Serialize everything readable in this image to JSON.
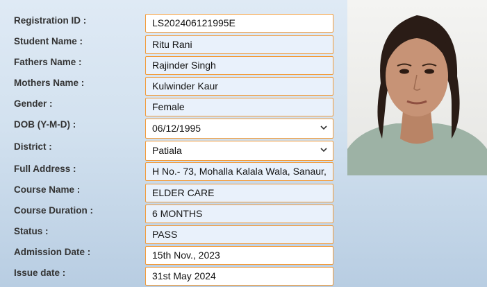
{
  "fields": [
    {
      "label": "Registration ID :",
      "value": "LS202406121995E",
      "style": "white"
    },
    {
      "label": "Student Name :",
      "value": "Ritu Rani",
      "style": "blue"
    },
    {
      "label": "Fathers Name :",
      "value": "Rajinder Singh",
      "style": "blue"
    },
    {
      "label": "Mothers Name :",
      "value": "Kulwinder Kaur",
      "style": "blue"
    },
    {
      "label": "Gender :",
      "value": "Female",
      "style": "blue"
    },
    {
      "label": "DOB (Y-M-D) :",
      "value": "06/12/1995",
      "style": "select"
    },
    {
      "label": "District :",
      "value": "Patiala",
      "style": "select"
    },
    {
      "label": "Full Address :",
      "value": "H No.- 73, Mohalla Kalala Wala, Sanaur,",
      "style": "blue"
    },
    {
      "label": "Course Name :",
      "value": "ELDER CARE",
      "style": "blue"
    },
    {
      "label": "Course Duration :",
      "value": "6 MONTHS",
      "style": "blue"
    },
    {
      "label": "Status :",
      "value": "PASS",
      "style": "blue"
    },
    {
      "label": "Admission Date :",
      "value": "15th Nov., 2023",
      "style": "white"
    },
    {
      "label": "Issue date :",
      "value": "31st May 2024",
      "style": "white"
    }
  ],
  "colors": {
    "field_border": "#f29b3a",
    "field_bg": "#e9f1fb"
  },
  "icons": {
    "select_arrow": "chevron-down-icon"
  }
}
